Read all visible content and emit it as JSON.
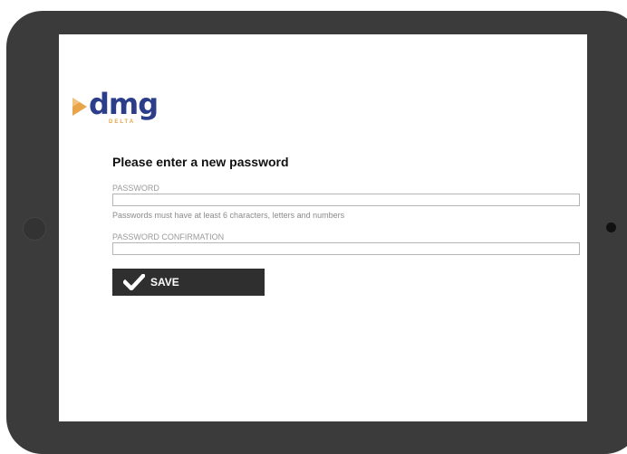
{
  "logo": {
    "word": "dmg",
    "sub": "DELTA"
  },
  "heading": "Please enter a new password",
  "password": {
    "label": "PASSWORD",
    "value": "",
    "hint": "Passwords must have at least 6 characters, letters and numbers"
  },
  "confirmation": {
    "label": "PASSWORD CONFIRMATION",
    "value": ""
  },
  "save_button": {
    "label": "SAVE",
    "icon": "check-icon"
  },
  "colors": {
    "brand_blue": "#2c3e8a",
    "brand_orange": "#e8a44a",
    "button_bg": "#2f2f2f",
    "frame": "#3b3b3b"
  }
}
